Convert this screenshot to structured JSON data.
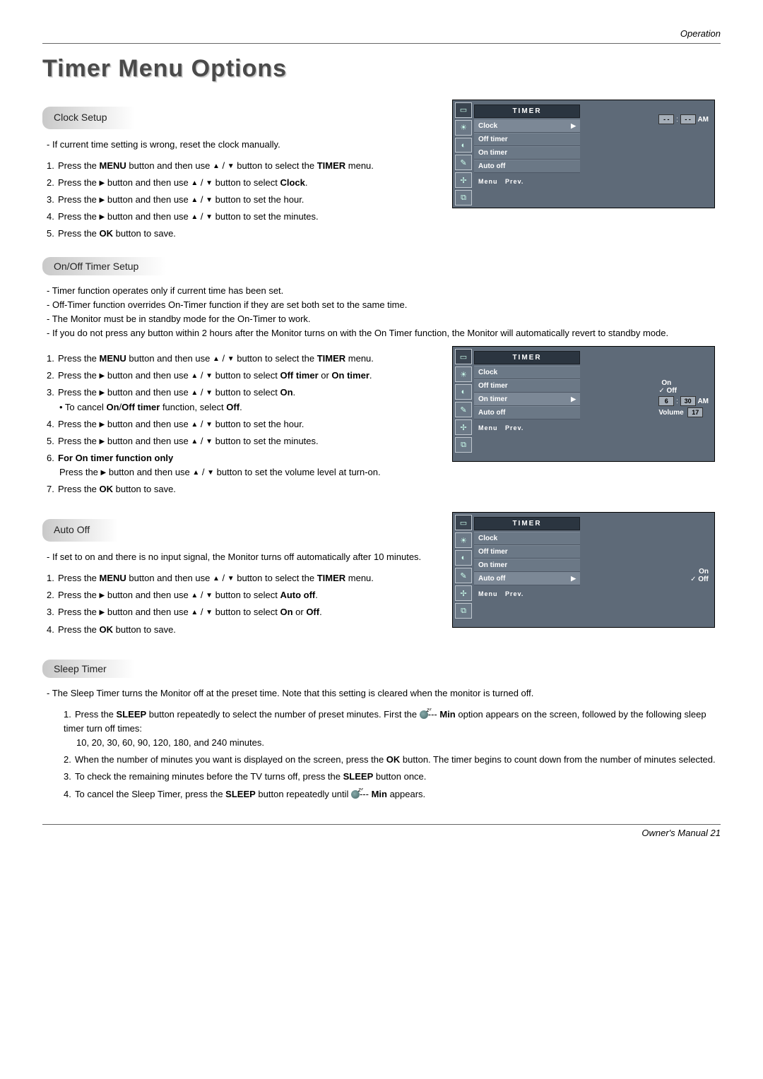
{
  "header": {
    "section": "Operation"
  },
  "title": "Timer Menu Options",
  "sections": {
    "clock": {
      "heading": "Clock Setup",
      "intro": "If current time setting is wrong, reset the clock manually.",
      "steps": {
        "s1a": "Press the ",
        "s1b": "MENU",
        "s1c": " button and then use ",
        "s1d": " button to select the ",
        "s1e": "TIMER",
        "s1f": " menu.",
        "s2a": "Press the ",
        "s2b": " button and then use ",
        "s2c": " button to select ",
        "s2d": "Clock",
        "s2e": ".",
        "s3a": "Press the ",
        "s3b": " button and then use ",
        "s3c": " button to set the hour.",
        "s4a": "Press the ",
        "s4b": " button and then use ",
        "s4c": " button to set the minutes.",
        "s5a": "Press the ",
        "s5b": "OK",
        "s5c": " button to save."
      }
    },
    "onoff": {
      "heading": "On/Off Timer Setup",
      "notes": {
        "n1": "Timer function operates only if current time has been set.",
        "n2": "Off-Timer function overrides On-Timer function if they are set both set to the same time.",
        "n3": "The Monitor must be in standby mode for the On-Timer to work.",
        "n4": "If you do not press any button within 2 hours after the Monitor turns on with the On Timer function, the Monitor will automatically revert to standby mode."
      },
      "steps": {
        "s1a": "Press the ",
        "s1b": "MENU",
        "s1c": " button and then use ",
        "s1d": " button to select the ",
        "s1e": "TIMER",
        "s1f": " menu.",
        "s2a": "Press the ",
        "s2b": " button and then use ",
        "s2c": " button to select ",
        "s2d": "Off timer",
        "s2e": " or ",
        "s2f": "On timer",
        "s2g": ".",
        "s3a": "Press the ",
        "s3b": " button and then use ",
        "s3c": " button to select ",
        "s3d": "On",
        "s3e": ".",
        "s3note_a": "• To cancel ",
        "s3note_b": "On",
        "s3note_c": "/",
        "s3note_d": "Off timer",
        "s3note_e": " function, select ",
        "s3note_f": "Off",
        "s3note_g": ".",
        "s4a": "Press the ",
        "s4b": " button and then use ",
        "s4c": " button to set the hour.",
        "s5a": "Press the ",
        "s5b": " button and then use ",
        "s5c": " button to set the minutes.",
        "s6hdr_a": "For ",
        "s6hdr_b": "On timer",
        "s6hdr_c": " function only",
        "s6a": "Press the ",
        "s6b": " button and then use ",
        "s6c": " button to set the volume level at turn-on.",
        "s7a": "Press the ",
        "s7b": "OK",
        "s7c": " button to save."
      }
    },
    "autooff": {
      "heading": "Auto Off",
      "intro": "If set to on and there is no input signal, the Monitor turns off automatically after 10 minutes.",
      "steps": {
        "s1a": "Press the ",
        "s1b": "MENU",
        "s1c": " button and then use ",
        "s1d": " button to select the ",
        "s1e": "TIMER",
        "s1f": " menu.",
        "s2a": "Press the ",
        "s2b": " button and then use ",
        "s2c": " button to select ",
        "s2d": "Auto off",
        "s2e": ".",
        "s3a": "Press the ",
        "s3b": " button and then use ",
        "s3c": " button to select ",
        "s3d": "On",
        "s3e": " or ",
        "s3f": "Off",
        "s3g": ".",
        "s4a": "Press the ",
        "s4b": "OK",
        "s4c": " button to save."
      }
    },
    "sleep": {
      "heading": "Sleep Timer",
      "intro": "The Sleep Timer turns the Monitor off at the preset time. Note that this setting is cleared when the monitor is turned off.",
      "steps": {
        "s1a": "Press the ",
        "s1b": "SLEEP",
        "s1c": " button repeatedly to select the number of preset minutes. First the ",
        "s1d": "--- ",
        "s1e": "Min",
        "s1f": " option appears on the screen, followed by the following sleep timer turn off times:",
        "s1g": "10, 20, 30, 60, 90, 120, 180, and 240 minutes.",
        "s2a": "When the number of minutes you want is displayed on the screen, press the ",
        "s2b": "OK",
        "s2c": " button. The timer begins to count down from the number of minutes selected.",
        "s3a": "To check the remaining minutes before the TV turns off, press the ",
        "s3b": "SLEEP",
        "s3c": " button once.",
        "s4a": "To cancel the Sleep Timer, press the ",
        "s4b": "SLEEP",
        "s4c": " button repeatedly until ",
        "s4d": "--- ",
        "s4e": "Min",
        "s4f": " appears."
      }
    }
  },
  "osd": {
    "title": "TIMER",
    "items": {
      "clock": "Clock",
      "off": "Off timer",
      "on": "On timer",
      "auto": "Auto off"
    },
    "footer_menu": "Menu",
    "footer_prev": "Prev.",
    "panel1": {
      "hh": "- -",
      "mm": "- -",
      "ampm": "AM"
    },
    "panel2": {
      "on": "On",
      "off": "Off",
      "h": "6",
      "m": "30",
      "ampm": "AM",
      "vol_lbl": "Volume",
      "vol": "17"
    },
    "panel3": {
      "on": "On",
      "off": "Off"
    }
  },
  "footer": {
    "text": "Owner's Manual  21"
  },
  "glyphs": {
    "up": "▲",
    "down": "▼",
    "right": "▶",
    "sep": " / "
  }
}
